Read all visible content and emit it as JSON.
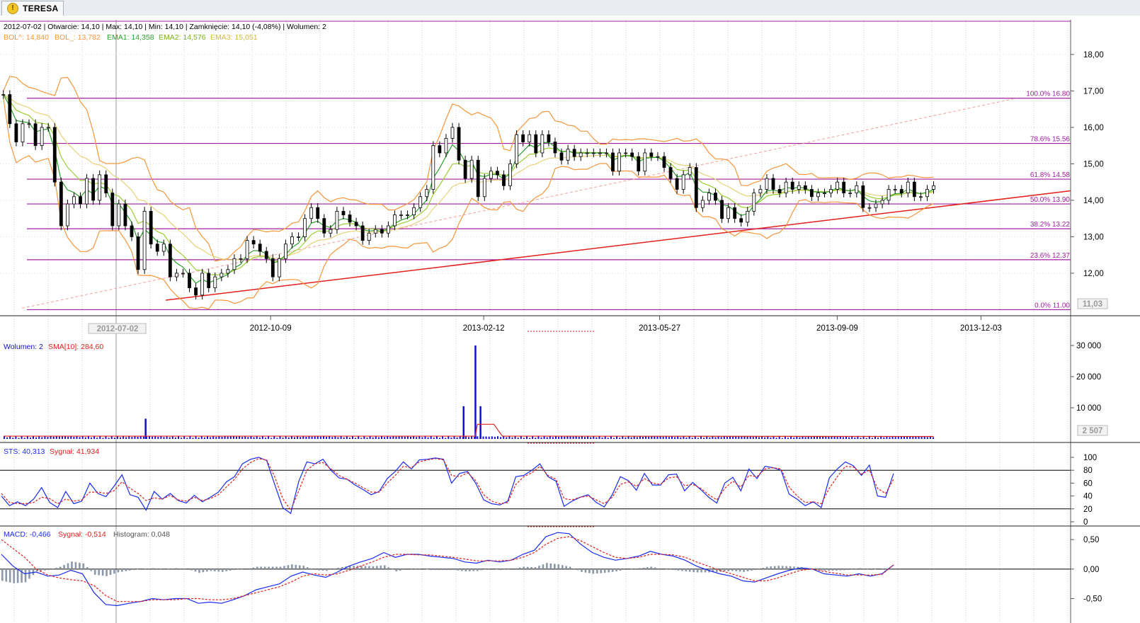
{
  "app": {
    "tab_title": "TERESA",
    "tab_icon": "warning-icon"
  },
  "info": {
    "line1": "2012-07-02 | Otwarcie: 14,10 | Max: 14,10 | Min: 14,10 | Zamknięcie: 14,10 (-4,08%)  | Wolumen: 2",
    "bol_up": "BOL^: 14,840",
    "bol_dn": "BOL_: 13,782",
    "ema1": "EMA1: 14,358",
    "ema2": "EMA2: 14,576",
    "ema3": "EMA3: 15,051"
  },
  "colors": {
    "fib": "#a01fa0",
    "bollinger": "#f5963c",
    "ema1": "#2ca02c",
    "ema2": "#9acd32",
    "ema3": "#e8d27a",
    "trend": "#e0201c",
    "volume": "#1010d0",
    "stoch": "#1a2cf0",
    "signal": "#e0201c",
    "hist": "#8c98a8"
  },
  "cursor": {
    "date_label": "2012-07-02",
    "price_label": "11,03",
    "volume_label": "2 507"
  },
  "chart_data": [
    {
      "type": "candlestick",
      "title": "",
      "x_tick_labels": [
        "2012-10-09",
        "2013-02-12",
        "2013-05-27",
        "2013-09-09",
        "2013-12-03"
      ],
      "xlim": [
        "2012-05-02",
        "2014-01-25"
      ],
      "ylim": [
        10.95,
        18.95
      ],
      "y_tick_labels": [
        "12,00",
        "13,00",
        "14,00",
        "15,00",
        "16,00",
        "17,00",
        "18,00"
      ],
      "fibonacci": [
        {
          "label": "100.0% 16.80",
          "value": 16.8
        },
        {
          "label": "78.6% 15.56",
          "value": 15.56
        },
        {
          "label": "61.8% 14.58",
          "value": 14.58
        },
        {
          "label": "50.0% 13.90",
          "value": 13.9
        },
        {
          "label": "38.2% 13.22",
          "value": 13.22
        },
        {
          "label": "23.6% 12.37",
          "value": 12.37
        },
        {
          "label": "0.0% 11.00",
          "value": 11.0
        }
      ],
      "trendlines": [
        {
          "style": "solid",
          "from": [
            "2012-08-08",
            11.26
          ],
          "to": [
            "2014-01-25",
            14.26
          ]
        },
        {
          "style": "dashed",
          "from": [
            "2012-05-15",
            11.04
          ],
          "to": [
            "2013-12-24",
            16.8
          ]
        }
      ],
      "close": [
        16.9,
        16.1,
        15.6,
        16.1,
        16.1,
        15.5,
        16.0,
        16.0,
        14.5,
        13.3,
        13.9,
        14.1,
        13.9,
        14.6,
        14.0,
        14.7,
        14.2,
        13.3,
        13.9,
        13.3,
        13.0,
        12.1,
        13.7,
        12.8,
        12.6,
        12.8,
        11.9,
        12.0,
        12.0,
        11.6,
        11.4,
        12.0,
        11.6,
        11.9,
        12.0,
        12.1,
        12.4,
        12.4,
        12.9,
        12.8,
        12.6,
        12.4,
        11.9,
        12.4,
        12.8,
        13.0,
        13.0,
        13.5,
        13.8,
        13.5,
        13.1,
        13.2,
        13.7,
        13.6,
        13.4,
        13.3,
        12.9,
        13.1,
        13.2,
        13.1,
        13.3,
        13.6,
        13.6,
        13.6,
        13.8,
        14.1,
        14.3,
        15.5,
        15.3,
        15.7,
        16.0,
        15.1,
        14.6,
        15.1,
        14.1,
        14.6,
        14.8,
        14.7,
        14.4,
        15.0,
        15.8,
        15.6,
        15.8,
        15.3,
        15.8,
        15.6,
        15.3,
        15.1,
        15.4,
        15.2,
        15.3,
        15.3,
        15.3,
        15.3,
        15.3,
        14.8,
        15.3,
        15.3,
        15.2,
        14.8,
        15.3,
        15.2,
        15.2,
        14.9,
        14.6,
        14.3,
        14.7,
        14.9,
        13.8,
        14.0,
        14.2,
        14.0,
        13.5,
        13.8,
        13.5,
        13.4,
        13.7,
        14.2,
        14.3,
        14.6,
        14.3,
        14.2,
        14.5,
        14.3,
        14.4,
        14.3,
        14.1,
        14.2,
        14.2,
        14.3,
        14.5,
        14.2,
        14.2,
        14.4,
        13.8,
        13.8,
        13.9,
        14.0,
        14.3,
        14.3,
        14.2,
        14.5,
        14.1,
        14.1,
        14.3,
        14.4
      ]
    },
    {
      "type": "bar",
      "title": "Wolumen: 2",
      "overlay": "SMA[10]: 284,60",
      "ylim": [
        0,
        30000
      ],
      "y_tick_labels": [
        "10 000",
        "20 000",
        "30 000"
      ],
      "spikes": [
        {
          "x": "2012-07-27",
          "value": 6500
        },
        {
          "x": "2013-01-31",
          "value": 10500
        },
        {
          "x": "2013-02-07",
          "value": 30000
        },
        {
          "x": "2013-02-10",
          "value": 10500
        }
      ],
      "sma_plateau": {
        "from": "2013-02-07",
        "to": "2013-02-18",
        "value": 4700
      },
      "baseline_bar_value": 800
    },
    {
      "type": "line",
      "title": "STS: 40,313",
      "signal_label": "Sygnał: 41,934",
      "ylim": [
        0,
        100
      ],
      "y_tick_labels": [
        "0",
        "20",
        "40",
        "60",
        "80",
        "100"
      ],
      "reference_levels": [
        20,
        80
      ],
      "series": [
        {
          "name": "STS",
          "values": [
            40,
            25,
            31,
            25,
            35,
            53,
            30,
            22,
            47,
            28,
            32,
            60,
            44,
            39,
            55,
            73,
            42,
            38,
            18,
            47,
            35,
            44,
            33,
            29,
            41,
            31,
            38,
            46,
            62,
            70,
            90,
            97,
            100,
            95,
            58,
            22,
            13,
            63,
            93,
            90,
            97,
            80,
            68,
            66,
            57,
            50,
            42,
            47,
            67,
            78,
            93,
            82,
            96,
            97,
            99,
            97,
            60,
            75,
            78,
            60,
            34,
            28,
            26,
            32,
            70,
            72,
            80,
            90,
            70,
            63,
            24,
            32,
            38,
            42,
            30,
            23,
            42,
            70,
            64,
            49,
            75,
            57,
            57,
            73,
            74,
            48,
            61,
            50,
            38,
            29,
            60,
            69,
            48,
            82,
            67,
            86,
            84,
            80,
            43,
            35,
            25,
            31,
            22,
            68,
            82,
            93,
            87,
            72,
            88,
            40,
            38,
            75
          ]
        },
        {
          "name": "Sygnał",
          "values": [
            44,
            30,
            28,
            28,
            30,
            38,
            36,
            28,
            35,
            32,
            34,
            46,
            46,
            44,
            48,
            62,
            52,
            44,
            33,
            37,
            35,
            41,
            34,
            32,
            38,
            33,
            36,
            42,
            54,
            66,
            82,
            92,
            98,
            96,
            70,
            36,
            18,
            48,
            80,
            90,
            92,
            82,
            72,
            66,
            60,
            53,
            46,
            46,
            60,
            72,
            86,
            84,
            93,
            96,
            98,
            96,
            72,
            70,
            76,
            64,
            42,
            32,
            28,
            30,
            58,
            70,
            76,
            86,
            72,
            66,
            36,
            34,
            38,
            40,
            34,
            28,
            38,
            58,
            62,
            55,
            67,
            60,
            58,
            68,
            70,
            56,
            58,
            52,
            42,
            34,
            52,
            63,
            54,
            72,
            70,
            82,
            84,
            82,
            54,
            40,
            30,
            31,
            28,
            52,
            70,
            86,
            85,
            74,
            80,
            52,
            44,
            66
          ]
        }
      ]
    },
    {
      "type": "line",
      "title": "MACD: -0,466",
      "signal_label": "Sygnał: -0,514",
      "histogram_label": "Histogram: 0,048",
      "ylim": [
        -0.65,
        0.55
      ],
      "y_tick_labels": [
        "-0,50",
        "0,00",
        "0,50"
      ],
      "series": [
        {
          "name": "MACD",
          "values": [
            0.25,
            0.05,
            -0.08,
            -0.05,
            -0.12,
            -0.1,
            -0.02,
            -0.08,
            -0.4,
            -0.6,
            -0.62,
            -0.58,
            -0.55,
            -0.5,
            -0.52,
            -0.5,
            -0.5,
            -0.58,
            -0.56,
            -0.58,
            -0.52,
            -0.45,
            -0.35,
            -0.3,
            -0.25,
            -0.12,
            -0.05,
            -0.1,
            -0.14,
            -0.05,
            0.05,
            0.12,
            0.18,
            0.28,
            0.2,
            0.25,
            0.25,
            0.22,
            0.2,
            0.18,
            0.12,
            0.1,
            0.15,
            0.12,
            0.15,
            0.25,
            0.32,
            0.55,
            0.62,
            0.6,
            0.42,
            0.28,
            0.2,
            0.15,
            0.18,
            0.22,
            0.3,
            0.25,
            0.22,
            0.15,
            0.05,
            -0.02,
            -0.08,
            -0.12,
            -0.2,
            -0.22,
            -0.15,
            -0.08,
            -0.02,
            0.02,
            0.0,
            -0.08,
            -0.1,
            -0.12,
            -0.08,
            -0.12,
            -0.08,
            0.07
          ]
        },
        {
          "name": "Sygnał",
          "values": [
            0.5,
            0.35,
            0.2,
            0.0,
            -0.1,
            -0.15,
            -0.18,
            -0.2,
            -0.28,
            -0.45,
            -0.55,
            -0.55,
            -0.55,
            -0.52,
            -0.52,
            -0.52,
            -0.5,
            -0.5,
            -0.52,
            -0.52,
            -0.5,
            -0.45,
            -0.4,
            -0.35,
            -0.3,
            -0.22,
            -0.12,
            -0.08,
            -0.1,
            -0.08,
            -0.02,
            0.05,
            0.12,
            0.2,
            0.25,
            0.25,
            0.24,
            0.24,
            0.22,
            0.2,
            0.17,
            0.14,
            0.14,
            0.14,
            0.15,
            0.2,
            0.28,
            0.42,
            0.52,
            0.55,
            0.48,
            0.38,
            0.28,
            0.2,
            0.18,
            0.2,
            0.25,
            0.25,
            0.24,
            0.2,
            0.12,
            0.05,
            -0.02,
            -0.08,
            -0.14,
            -0.2,
            -0.2,
            -0.15,
            -0.08,
            -0.02,
            0.0,
            -0.04,
            -0.07,
            -0.1,
            -0.1,
            -0.1,
            -0.09,
            0.07
          ]
        }
      ]
    }
  ]
}
